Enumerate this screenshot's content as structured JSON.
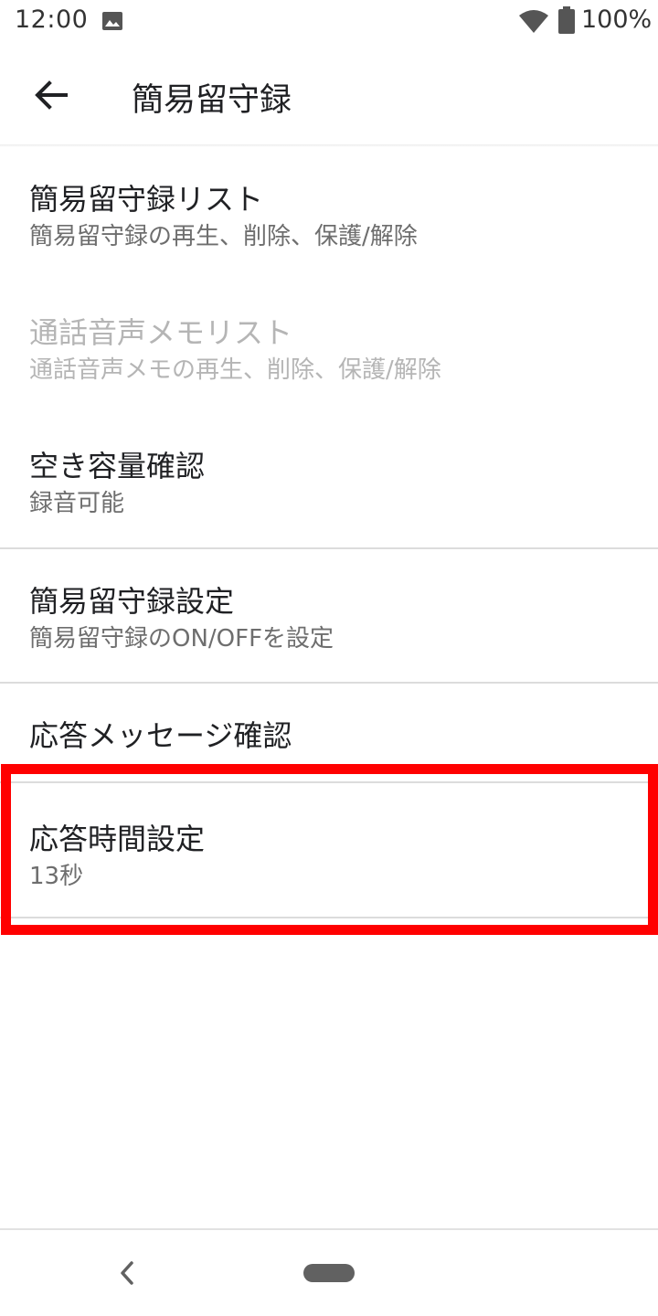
{
  "status_bar": {
    "time": "12:00",
    "battery": "100%",
    "icons": [
      "image-icon",
      "wifi-icon",
      "battery-icon"
    ]
  },
  "app_bar": {
    "title": "簡易留守録",
    "back_icon": "arrow-left-icon"
  },
  "menu": {
    "list": {
      "title": "簡易留守録リスト",
      "subtitle": "簡易留守録の再生、削除、保護/解除"
    },
    "memo": {
      "title": "通話音声メモリスト",
      "subtitle": "通話音声メモの再生、削除、保護/解除",
      "enabled": false
    },
    "storage": {
      "title": "空き容量確認",
      "subtitle": "録音可能"
    },
    "settings": {
      "title": "簡易留守録設定",
      "subtitle": "簡易留守録のON/OFFを設定"
    },
    "message": {
      "title": "応答メッセージ確認"
    },
    "time": {
      "title": "応答時間設定",
      "subtitle": "13秒"
    }
  },
  "colors": {
    "highlight": "#ff0000",
    "text_primary": "#202124",
    "text_secondary": "#6e6e6e",
    "text_disabled": "#b5b5b5"
  },
  "nav_bar": {
    "back_icon": "nav-back-icon",
    "home_icon": "nav-home-pill"
  }
}
